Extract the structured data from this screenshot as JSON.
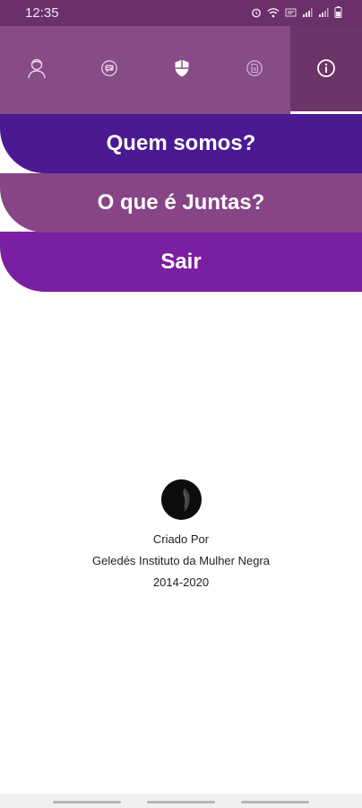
{
  "status_bar": {
    "time": "12:35"
  },
  "tabs": [
    {
      "icon": "user-icon",
      "active": false
    },
    {
      "icon": "chat-icon",
      "active": false
    },
    {
      "icon": "shield-icon",
      "active": false
    },
    {
      "icon": "document-icon",
      "active": false
    },
    {
      "icon": "info-icon",
      "active": true
    }
  ],
  "menu": {
    "quem_somos": "Quem somos?",
    "o_que_e_juntas": "O que é Juntas?",
    "sair": "Sair"
  },
  "credits": {
    "line1": "Criado Por",
    "line2": "Geledés Instituto da Mulher Negra",
    "line3": "2014-2020"
  },
  "colors": {
    "status_bar": "#6b2f6c",
    "tab_bar": "#874b87",
    "tab_active": "#6c3469",
    "quem_somos": "#4b1a93",
    "juntas": "#874487",
    "sair": "#7b1fa2"
  }
}
